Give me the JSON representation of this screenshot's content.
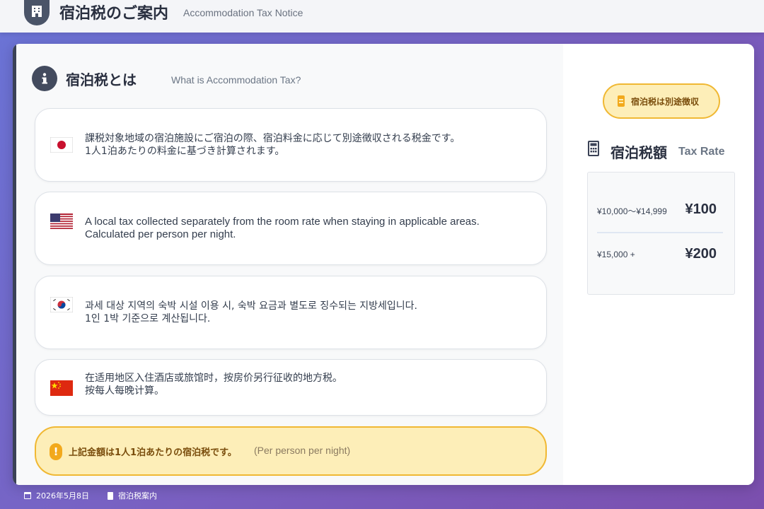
{
  "header": {
    "title": "宿泊税のご案内",
    "subtitle": "Accommodation Tax Notice",
    "icon": "hotel-icon"
  },
  "section": {
    "title": "宿泊税とは",
    "subtitle": "What is Accommodation Tax?",
    "icon": "info-icon"
  },
  "languages": [
    {
      "flag": "japan-flag-icon",
      "line1": "課税対象地域の宿泊施設にご宿泊の際、宿泊料金に応じて別途徴収される税金です。",
      "line2": "1人1泊あたりの料金に基づき計算されます。"
    },
    {
      "flag": "usa-flag-icon",
      "line1": "A local tax collected separately from the room rate when staying in applicable areas.",
      "line2": "Calculated per person per night."
    },
    {
      "flag": "korea-flag-icon",
      "line1": "과세 대상 지역의 숙박 시설 이용 시, 숙박 요금과 별도로 징수되는 지방세입니다.",
      "line2": "1인 1박 기준으로 계산됩니다."
    },
    {
      "flag": "china-flag-icon",
      "line1": "在适用地区入住酒店或旅馆时，按房价另行征收的地方税。",
      "line2": "按每人每晚计算。"
    }
  ],
  "notice": {
    "main": "上記金額は1人1泊あたりの宿泊税です。",
    "sub": "(Per person per night)"
  },
  "badge": {
    "label": "宿泊税は別途徴収"
  },
  "rates": {
    "title": "宿泊税額",
    "subtitle": "Tax Rate",
    "rows": [
      {
        "range": "¥10,000〜¥14,999",
        "amount": "¥100"
      },
      {
        "range": "¥15,000 +",
        "amount": "¥200"
      }
    ]
  },
  "footer": {
    "date": "2026年5月8日",
    "doc": "宿泊税案内"
  },
  "colors": {
    "accent": "#f0b833",
    "notice_bg": "#fdeeb8",
    "dark": "#3b4256"
  }
}
